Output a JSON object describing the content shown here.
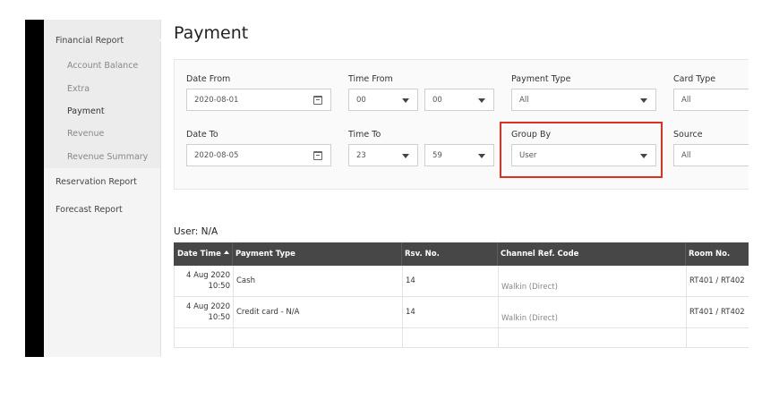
{
  "sidebar": {
    "financial_report": "Financial Report",
    "sub_items": [
      "Account Balance",
      "Extra",
      "Payment",
      "Revenue",
      "Revenue Summary"
    ],
    "active_item": "Payment",
    "reservation_report": "Reservation Report",
    "forecast_report": "Forecast Report"
  },
  "main": {
    "title": "Payment"
  },
  "filters": {
    "date_from": {
      "label": "Date From",
      "value": "2020-08-01",
      "icon": "calendar-icon"
    },
    "time_from": {
      "label": "Time From",
      "hour": "00",
      "minute": "00"
    },
    "payment_type": {
      "label": "Payment Type",
      "value": "All"
    },
    "card_type": {
      "label": "Card Type",
      "value": "All"
    },
    "date_to": {
      "label": "Date To",
      "value": "2020-08-05",
      "icon": "calendar-icon"
    },
    "time_to": {
      "label": "Time To",
      "hour": "23",
      "minute": "59"
    },
    "group_by": {
      "label": "Group By",
      "value": "User"
    },
    "source": {
      "label": "Source",
      "value": "All"
    }
  },
  "group_title": "User: N/A",
  "table": {
    "columns": [
      "Date Time",
      "Payment Type",
      "Rsv. No.",
      "Channel Ref. Code",
      "Room No."
    ],
    "sort_icon": "sort-ascending-icon",
    "rows": [
      {
        "date": "4 Aug 2020",
        "time": "10:50",
        "payment_type": "Cash",
        "rsv_no": "14",
        "channel": "Walkin (Direct)",
        "room": "RT401 / RT402"
      },
      {
        "date": "4 Aug 2020",
        "time": "10:50",
        "payment_type": "Credit card - N/A",
        "rsv_no": "14",
        "channel": "Walkin (Direct)",
        "room": "RT401 / RT402"
      }
    ]
  },
  "colors": {
    "highlight": "#e0301e",
    "table_header": "#474747",
    "sidebar_bg": "#f4f4f4"
  }
}
